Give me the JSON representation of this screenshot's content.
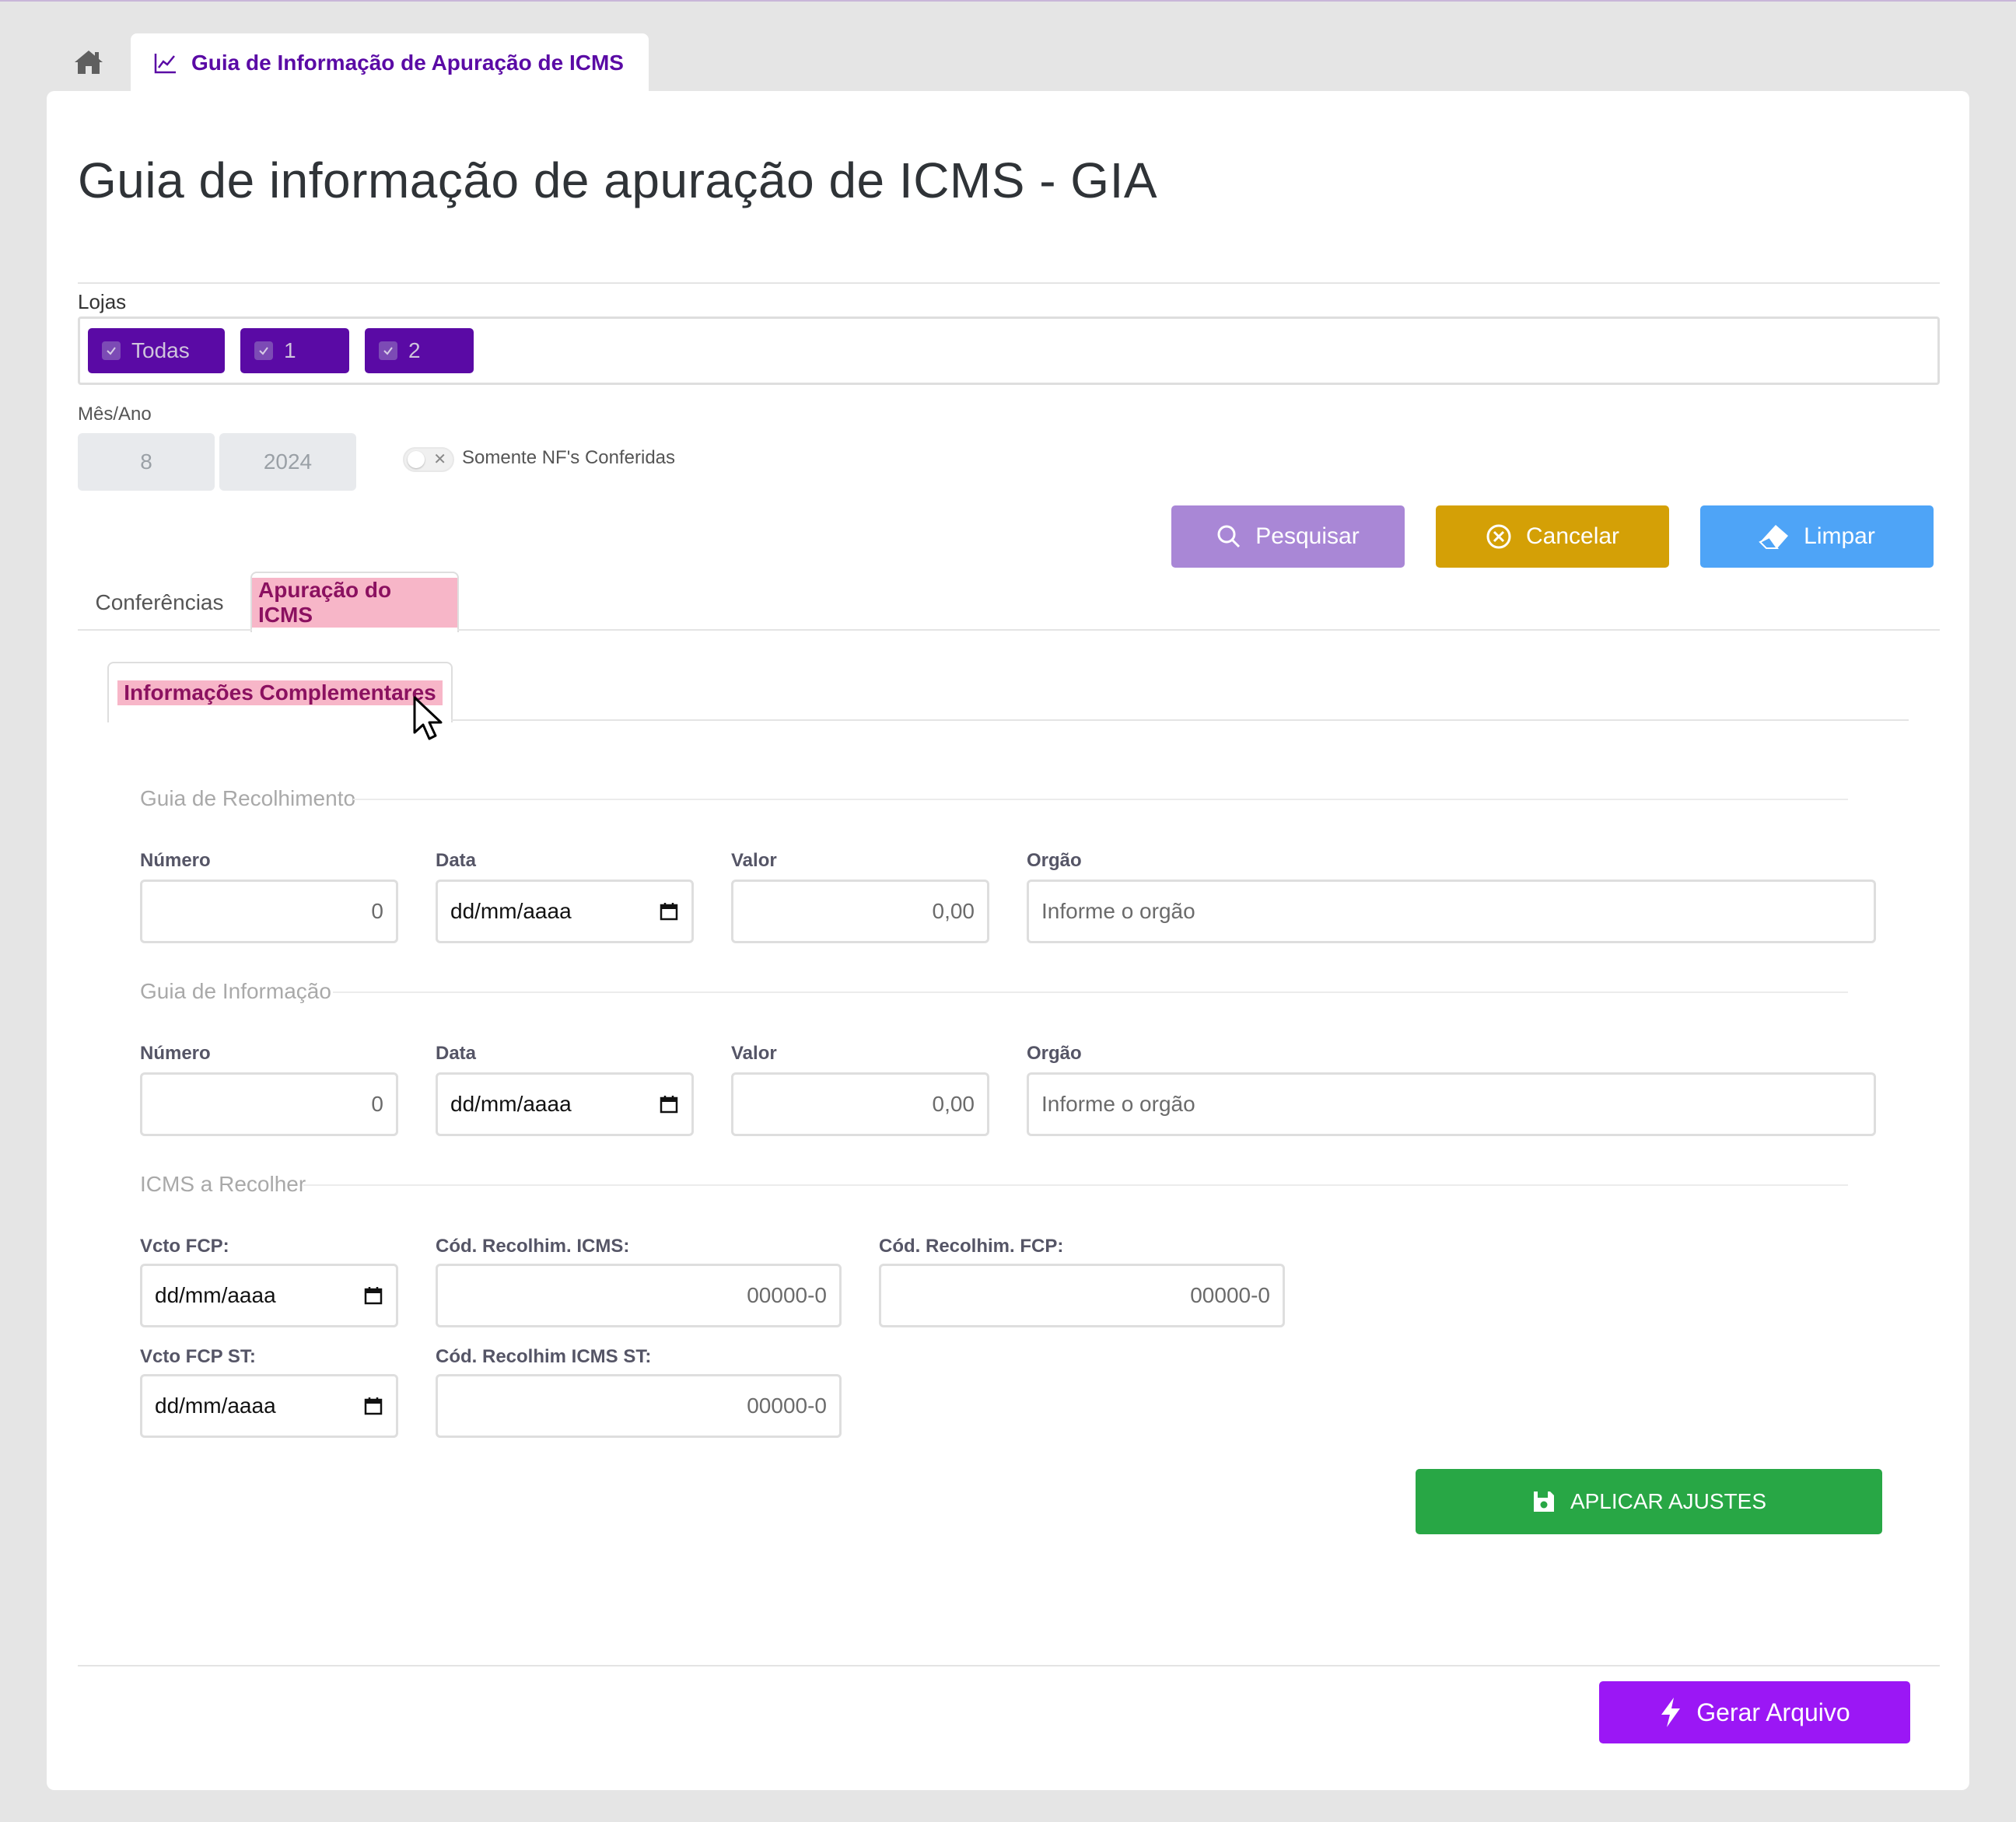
{
  "topbar": {
    "tab_title": "Guia de Informação de Apuração de ICMS"
  },
  "page": {
    "title": "Guia de informação de apuração de ICMS - GIA"
  },
  "lojas": {
    "label": "Lojas",
    "chips": [
      "Todas",
      "1",
      "2"
    ]
  },
  "periodo": {
    "label": "Mês/Ano",
    "mes": "8",
    "ano": "2024"
  },
  "filtro": {
    "toggle_label": "Somente NF's Conferidas",
    "toggle_on": false
  },
  "actions": {
    "pesquisar": "Pesquisar",
    "cancelar": "Cancelar",
    "limpar": "Limpar"
  },
  "tabs": {
    "conferencias": "Conferências",
    "apuracao": "Apuração do ICMS",
    "sub_info": "Informações Complementares"
  },
  "guia_recolhimento": {
    "legend": "Guia de Recolhimento",
    "numero_label": "Número",
    "numero_value": "0",
    "data_label": "Data",
    "data_placeholder": "dd/mm/aaaa",
    "valor_label": "Valor",
    "valor_value": "0,00",
    "orgao_label": "Orgão",
    "orgao_placeholder": "Informe o orgão"
  },
  "guia_informacao": {
    "legend": "Guia de Informação",
    "numero_label": "Número",
    "numero_value": "0",
    "data_label": "Data",
    "data_placeholder": "dd/mm/aaaa",
    "valor_label": "Valor",
    "valor_value": "0,00",
    "orgao_label": "Orgão",
    "orgao_placeholder": "Informe o orgão"
  },
  "icms_recolher": {
    "legend": "ICMS a Recolher",
    "vcto_fcp_label": "Vcto FCP:",
    "vcto_fcp_placeholder": "dd/mm/aaaa",
    "cod_icms_label": "Cód. Recolhim. ICMS:",
    "cod_icms_placeholder": "00000-0",
    "cod_fcp_label": "Cód. Recolhim. FCP:",
    "cod_fcp_placeholder": "00000-0",
    "vcto_fcp_st_label": "Vcto FCP ST:",
    "vcto_fcp_st_placeholder": "dd/mm/aaaa",
    "cod_icms_st_label": "Cód. Recolhim ICMS ST:",
    "cod_icms_st_placeholder": "00000-0"
  },
  "footer": {
    "aplicar": "APLICAR AJUSTES",
    "gerar": "Gerar Arquivo"
  },
  "colors": {
    "brand_purple": "#5a0aa5",
    "pesquisar": "#a987d6",
    "cancelar": "#d4a006",
    "limpar": "#4ea4f7",
    "aplicar": "#28a745",
    "gerar": "#9b17f5"
  }
}
